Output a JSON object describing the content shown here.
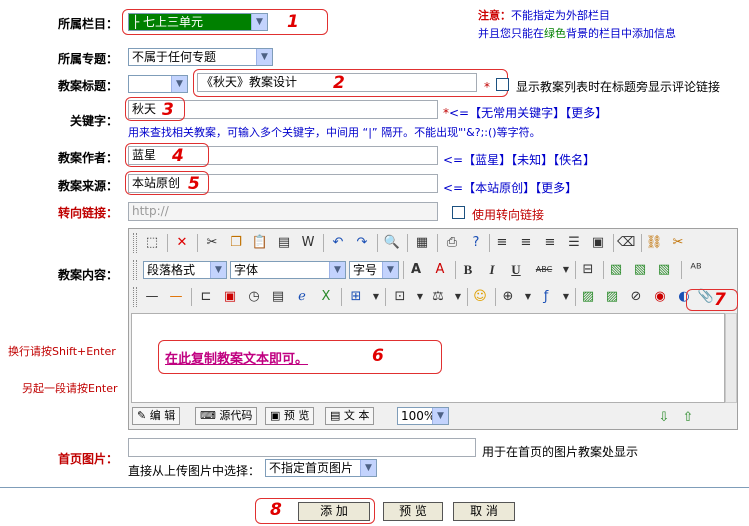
{
  "notice": {
    "prefix": "注意：",
    "line1": "不能指定为外部栏目",
    "line2_a": "并且您只能在",
    "line2_green": "绿色",
    "line2_b": "背景的栏目中添加信息"
  },
  "fields": {
    "column": {
      "label": "所属栏目：",
      "value": "├ 七上三单元"
    },
    "topic": {
      "label": "所属专题：",
      "value": "不属于任何专题"
    },
    "title": {
      "label": "教案标题：",
      "prefix_value": "",
      "value": "《秋天》教案设计",
      "required_mark": "*",
      "checkbox_label": "显示教案列表时在标题旁显示评论链接"
    },
    "keywords": {
      "label": "关键字：",
      "value": "秋天",
      "required_mark": "*",
      "link_prefix": "<=",
      "link1": "【无常用关键字】",
      "link2": "【更多】",
      "hint": "用来查找相关教案，可输入多个关键字，中间用 “|” 隔开。不能出现\"'&?;:()等字符。"
    },
    "author": {
      "label": "教案作者：",
      "value": "蓝星",
      "link_prefix": "<=",
      "link1": "【蓝星】",
      "link2": "【未知】",
      "link3": "【佚名】"
    },
    "source": {
      "label": "教案来源：",
      "value": "本站原创",
      "link_prefix": "<=",
      "link1": "【本站原创】",
      "link2": "【更多】"
    },
    "redirect": {
      "label": "转向链接：",
      "placeholder": "http://",
      "checkbox_label": "使用转向链接"
    },
    "content": {
      "label": "教案内容：",
      "side_hint1": "换行请按Shift+Enter",
      "side_hint2": "另起一段请按Enter",
      "body_text": "在此复制教案文本即可。"
    },
    "home_image": {
      "label": "首页图片：",
      "value": "",
      "hint": "用于在首页的图片教案处显示",
      "upload_label": "直接从上传图片中选择：",
      "upload_value": "不指定首页图片"
    }
  },
  "editor": {
    "format_select": "段落格式",
    "font_select": "字体",
    "size_select": "字号",
    "bold": "B",
    "italic": "I",
    "underline": "U",
    "abc": "ABC",
    "modes": {
      "edit": "编 辑",
      "source": "源代码",
      "preview": "预 览",
      "text": "文 本"
    },
    "zoom": "100%"
  },
  "callouts": [
    "1",
    "2",
    "3",
    "4",
    "5",
    "6",
    "7",
    "8"
  ],
  "buttons": {
    "add": "添 加",
    "preview": "预 览",
    "cancel": "取 消"
  },
  "colors": {
    "label_red": "#c00000",
    "link_blue": "#0000cc",
    "callout_red": "#e00000",
    "column_green": "#008000"
  }
}
